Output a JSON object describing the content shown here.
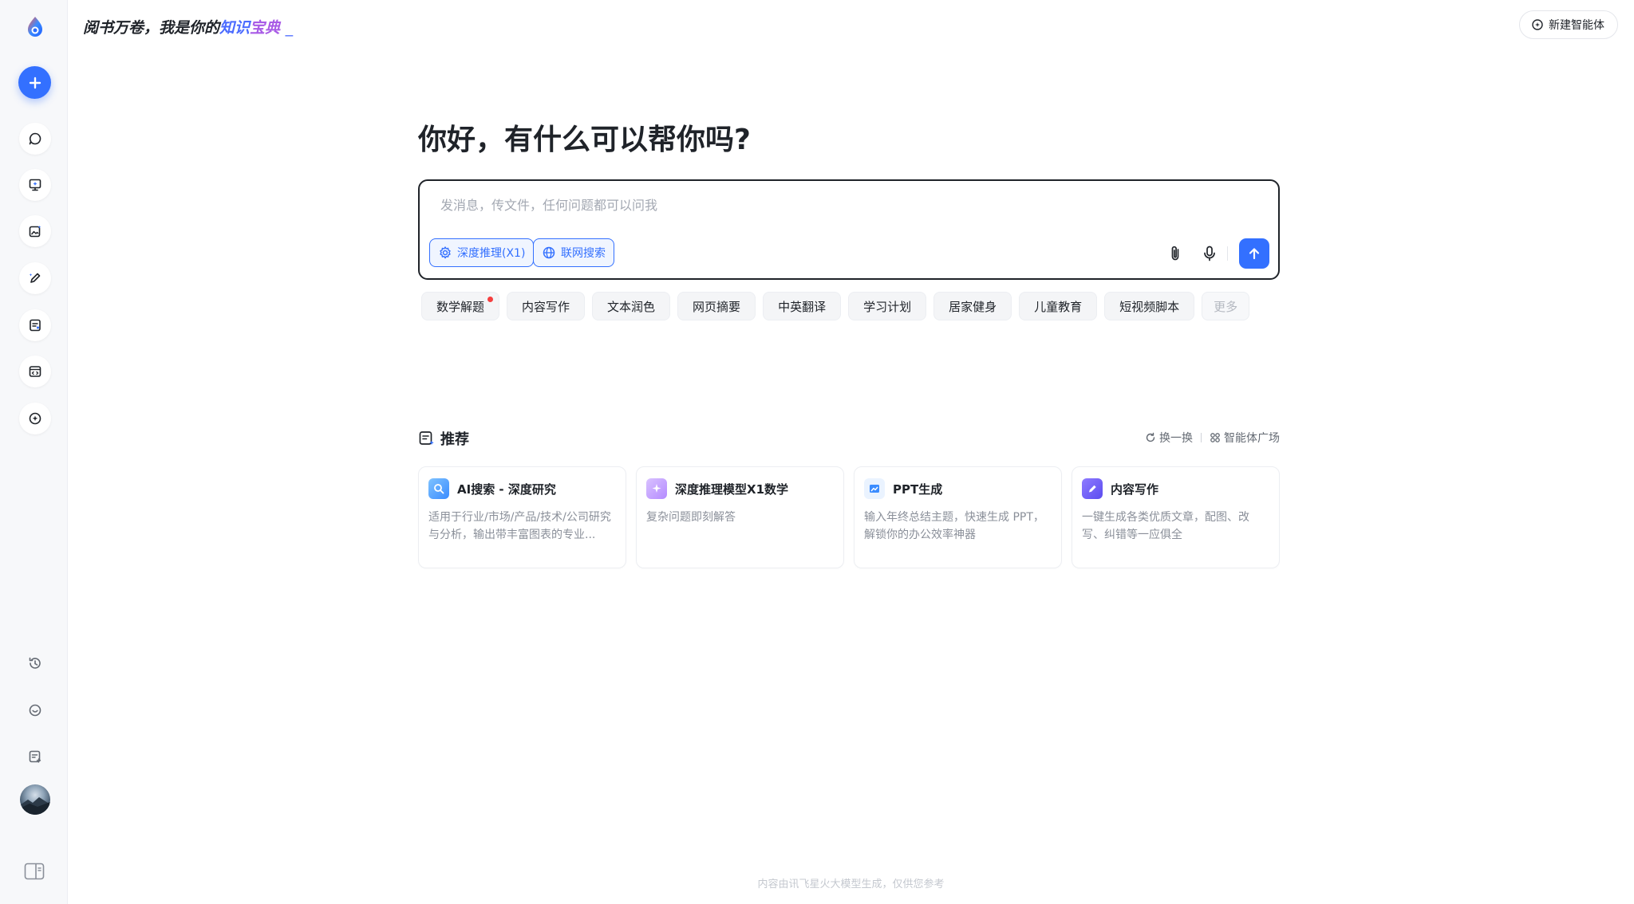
{
  "header": {
    "slogan_prefix": "阅书万卷，我是你的",
    "slogan_hl1": "知识",
    "slogan_hl2": "宝典",
    "slogan_cursor": "_",
    "new_agent_label": "新建智能体"
  },
  "sidebar": {
    "items": [
      {
        "icon": "chat-icon"
      },
      {
        "icon": "ppt-icon"
      },
      {
        "icon": "image-create-icon"
      },
      {
        "icon": "writing-icon"
      },
      {
        "icon": "document-icon"
      },
      {
        "icon": "code-icon"
      },
      {
        "icon": "agent-icon"
      }
    ],
    "bottom_items": [
      {
        "icon": "history-icon"
      },
      {
        "icon": "feedback-icon"
      },
      {
        "icon": "notes-icon"
      }
    ]
  },
  "main": {
    "greeting": "你好，有什么可以帮你吗?",
    "input_placeholder": "发消息，传文件，任何问题都可以问我",
    "mode_deep_reasoning": "深度推理(X1)",
    "mode_web_search": "联网搜索",
    "chips": [
      "数学解题",
      "内容写作",
      "文本润色",
      "网页摘要",
      "中英翻译",
      "学习计划",
      "居家健身",
      "儿童教育",
      "短视频脚本"
    ],
    "chip_more": "更多",
    "recommend_title": "推荐",
    "refresh_label": "换一换",
    "agent_square_label": "智能体广场",
    "cards": [
      {
        "title": "AI搜索 - 深度研究",
        "desc": "适用于行业/市场/产品/技术/公司研究与分析，输出带丰富图表的专业..."
      },
      {
        "title": "深度推理模型X1数学",
        "desc": "复杂问题即刻解答"
      },
      {
        "title": "PPT生成",
        "desc": "输入年终总结主题，快速生成 PPT，解锁你的办公效率神器"
      },
      {
        "title": "内容写作",
        "desc": "一键生成各类优质文章，配图、改写、纠错等一应俱全"
      }
    ]
  },
  "footer": {
    "note": "内容由讯飞星火大模型生成，仅供您参考"
  },
  "colors": {
    "accent": "#3370ff",
    "text": "#1f2329",
    "muted": "#8a8f99",
    "badge_dot": "#f53f3f"
  }
}
